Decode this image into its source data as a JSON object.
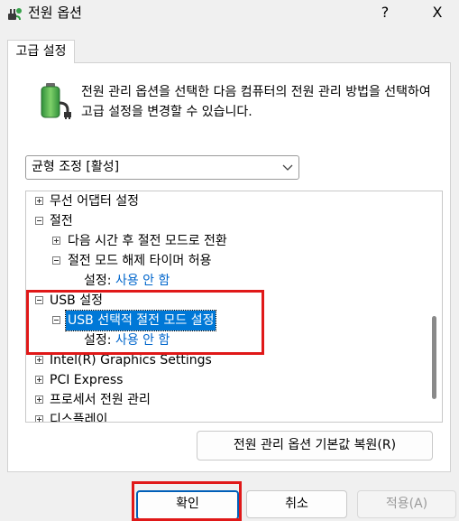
{
  "window": {
    "title": "전원 옵션",
    "help_label": "?",
    "close_label": "X",
    "icon": "power-plug-icon"
  },
  "tab": {
    "label": "고급 설정"
  },
  "description": "전원 관리 옵션을 선택한 다음 컴퓨터의 전원 관리 방법을 선택하여 고급 설정을 변경할 수 있습니다.",
  "plan_combo": {
    "value": "균형 조정 [활성]"
  },
  "tree": {
    "items": [
      {
        "label": "무선 어댑터 설정"
      },
      {
        "label": "절전"
      },
      {
        "label": "다음 시간 후 절전 모드로 전환"
      },
      {
        "label": "절전 모드 해제 타이머 허용"
      },
      {
        "label": "설정:",
        "value": "사용 안 함"
      },
      {
        "label": "USB 설정"
      },
      {
        "label": "USB 선택적 절전 모드 설정"
      },
      {
        "label": "설정:",
        "value": "사용 안 함"
      },
      {
        "label": "Intel(R) Graphics Settings"
      },
      {
        "label": "PCI Express"
      },
      {
        "label": "프로세서 전원 관리"
      },
      {
        "label": "디스플레이"
      }
    ]
  },
  "buttons": {
    "restore": "전원 관리 옵션 기본값 복원(R)",
    "ok": "확인",
    "cancel": "취소",
    "apply": "적용(A)"
  },
  "colors": {
    "accent": "#0078d7",
    "link": "#0066cc",
    "highlight": "#e01818"
  }
}
